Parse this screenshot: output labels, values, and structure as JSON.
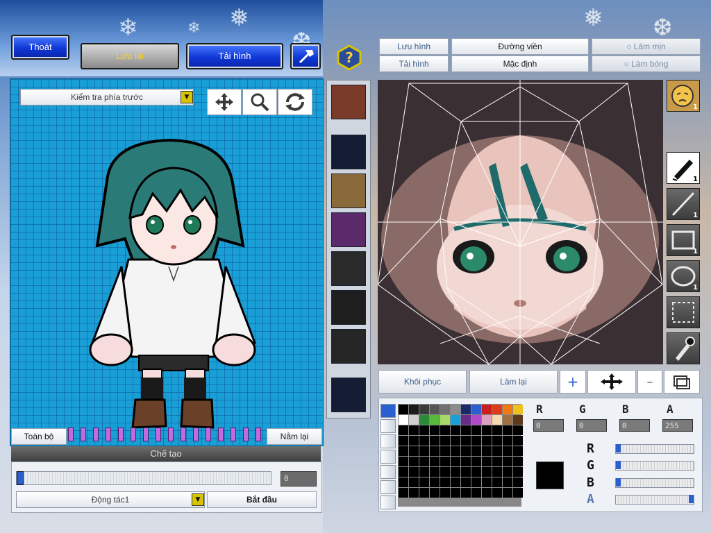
{
  "top_bar": {
    "exit_label": "Thoát",
    "save_label": "Lưu lại",
    "reload_label": "Tải hình"
  },
  "face_toolbar": {
    "save_image_label": "Lưu hình",
    "reload_image_label": "Tải hình",
    "outline_label": "Đường viền",
    "default_label": "Mặc định",
    "smooth_label": "Làm mịn",
    "shadow_label": "Làm bóng"
  },
  "preview": {
    "view_select_value": "Kiểm tra phía trước",
    "all_label": "Toàn bộ",
    "lie_down_label": "Nằm lại"
  },
  "craft": {
    "title": "Chế tạo",
    "slider_value": "0",
    "motion_select_value": "Động tác1",
    "start_label": "Bắt đầu"
  },
  "face_actions": {
    "restore_label": "Khôi phục",
    "redo_label": "Làm lại"
  },
  "tools": {
    "avatar_count": "1",
    "pen_count": "1",
    "line_count": "1",
    "rect_count": "1",
    "ellipse_count": "1"
  },
  "color": {
    "r_label": "R",
    "g_label": "G",
    "b_label": "B",
    "a_label": "A",
    "r_value": "0",
    "g_value": "0",
    "b_value": "0",
    "a_value": "255",
    "current": "#000000",
    "palette_row1": [
      "#000000",
      "#1c1c1c",
      "#3a3a3a",
      "#555555",
      "#707070",
      "#8c8c8c",
      "#1a2a6c",
      "#2a5fd0",
      "#c81e1e",
      "#e03a1a",
      "#f07a10",
      "#f0c020"
    ],
    "palette_row2": [
      "#ffffff",
      "#d0d0d0",
      "#2a8a3a",
      "#5ab83a",
      "#a6d86a",
      "#1aa0d8",
      "#6a2a8a",
      "#b04ac8",
      "#e0a0c0",
      "#f5d8b0",
      "#a07040",
      "#5a3a1a"
    ]
  },
  "accent_colors": {
    "grid_blue": "#1a9ed6",
    "button_blue": "#1037d6",
    "slider_blue": "#2a5fd0"
  }
}
